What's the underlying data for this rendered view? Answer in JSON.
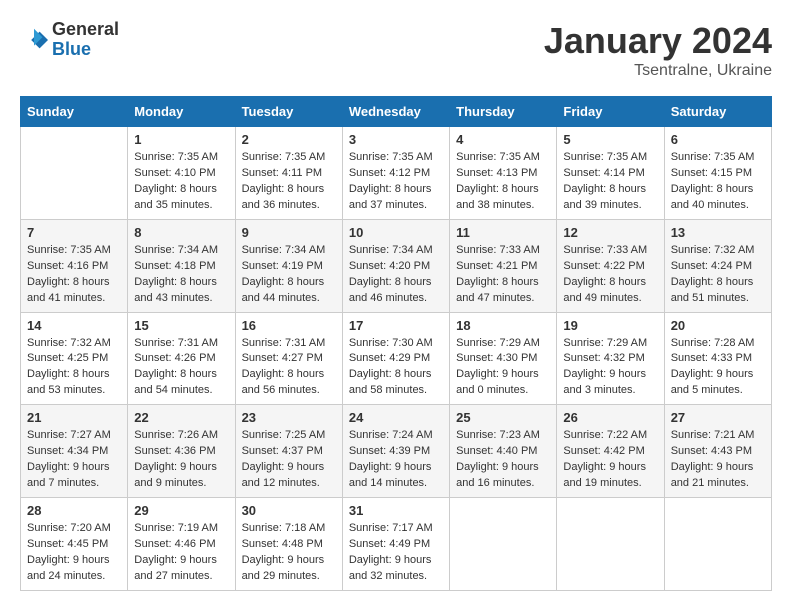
{
  "logo": {
    "general": "General",
    "blue": "Blue"
  },
  "header": {
    "month": "January 2024",
    "location": "Tsentralne, Ukraine"
  },
  "days_of_week": [
    "Sunday",
    "Monday",
    "Tuesday",
    "Wednesday",
    "Thursday",
    "Friday",
    "Saturday"
  ],
  "weeks": [
    [
      {
        "day": "",
        "info": ""
      },
      {
        "day": "1",
        "info": "Sunrise: 7:35 AM\nSunset: 4:10 PM\nDaylight: 8 hours\nand 35 minutes."
      },
      {
        "day": "2",
        "info": "Sunrise: 7:35 AM\nSunset: 4:11 PM\nDaylight: 8 hours\nand 36 minutes."
      },
      {
        "day": "3",
        "info": "Sunrise: 7:35 AM\nSunset: 4:12 PM\nDaylight: 8 hours\nand 37 minutes."
      },
      {
        "day": "4",
        "info": "Sunrise: 7:35 AM\nSunset: 4:13 PM\nDaylight: 8 hours\nand 38 minutes."
      },
      {
        "day": "5",
        "info": "Sunrise: 7:35 AM\nSunset: 4:14 PM\nDaylight: 8 hours\nand 39 minutes."
      },
      {
        "day": "6",
        "info": "Sunrise: 7:35 AM\nSunset: 4:15 PM\nDaylight: 8 hours\nand 40 minutes."
      }
    ],
    [
      {
        "day": "7",
        "info": "Sunrise: 7:35 AM\nSunset: 4:16 PM\nDaylight: 8 hours\nand 41 minutes."
      },
      {
        "day": "8",
        "info": "Sunrise: 7:34 AM\nSunset: 4:18 PM\nDaylight: 8 hours\nand 43 minutes."
      },
      {
        "day": "9",
        "info": "Sunrise: 7:34 AM\nSunset: 4:19 PM\nDaylight: 8 hours\nand 44 minutes."
      },
      {
        "day": "10",
        "info": "Sunrise: 7:34 AM\nSunset: 4:20 PM\nDaylight: 8 hours\nand 46 minutes."
      },
      {
        "day": "11",
        "info": "Sunrise: 7:33 AM\nSunset: 4:21 PM\nDaylight: 8 hours\nand 47 minutes."
      },
      {
        "day": "12",
        "info": "Sunrise: 7:33 AM\nSunset: 4:22 PM\nDaylight: 8 hours\nand 49 minutes."
      },
      {
        "day": "13",
        "info": "Sunrise: 7:32 AM\nSunset: 4:24 PM\nDaylight: 8 hours\nand 51 minutes."
      }
    ],
    [
      {
        "day": "14",
        "info": "Sunrise: 7:32 AM\nSunset: 4:25 PM\nDaylight: 8 hours\nand 53 minutes."
      },
      {
        "day": "15",
        "info": "Sunrise: 7:31 AM\nSunset: 4:26 PM\nDaylight: 8 hours\nand 54 minutes."
      },
      {
        "day": "16",
        "info": "Sunrise: 7:31 AM\nSunset: 4:27 PM\nDaylight: 8 hours\nand 56 minutes."
      },
      {
        "day": "17",
        "info": "Sunrise: 7:30 AM\nSunset: 4:29 PM\nDaylight: 8 hours\nand 58 minutes."
      },
      {
        "day": "18",
        "info": "Sunrise: 7:29 AM\nSunset: 4:30 PM\nDaylight: 9 hours\nand 0 minutes."
      },
      {
        "day": "19",
        "info": "Sunrise: 7:29 AM\nSunset: 4:32 PM\nDaylight: 9 hours\nand 3 minutes."
      },
      {
        "day": "20",
        "info": "Sunrise: 7:28 AM\nSunset: 4:33 PM\nDaylight: 9 hours\nand 5 minutes."
      }
    ],
    [
      {
        "day": "21",
        "info": "Sunrise: 7:27 AM\nSunset: 4:34 PM\nDaylight: 9 hours\nand 7 minutes."
      },
      {
        "day": "22",
        "info": "Sunrise: 7:26 AM\nSunset: 4:36 PM\nDaylight: 9 hours\nand 9 minutes."
      },
      {
        "day": "23",
        "info": "Sunrise: 7:25 AM\nSunset: 4:37 PM\nDaylight: 9 hours\nand 12 minutes."
      },
      {
        "day": "24",
        "info": "Sunrise: 7:24 AM\nSunset: 4:39 PM\nDaylight: 9 hours\nand 14 minutes."
      },
      {
        "day": "25",
        "info": "Sunrise: 7:23 AM\nSunset: 4:40 PM\nDaylight: 9 hours\nand 16 minutes."
      },
      {
        "day": "26",
        "info": "Sunrise: 7:22 AM\nSunset: 4:42 PM\nDaylight: 9 hours\nand 19 minutes."
      },
      {
        "day": "27",
        "info": "Sunrise: 7:21 AM\nSunset: 4:43 PM\nDaylight: 9 hours\nand 21 minutes."
      }
    ],
    [
      {
        "day": "28",
        "info": "Sunrise: 7:20 AM\nSunset: 4:45 PM\nDaylight: 9 hours\nand 24 minutes."
      },
      {
        "day": "29",
        "info": "Sunrise: 7:19 AM\nSunset: 4:46 PM\nDaylight: 9 hours\nand 27 minutes."
      },
      {
        "day": "30",
        "info": "Sunrise: 7:18 AM\nSunset: 4:48 PM\nDaylight: 9 hours\nand 29 minutes."
      },
      {
        "day": "31",
        "info": "Sunrise: 7:17 AM\nSunset: 4:49 PM\nDaylight: 9 hours\nand 32 minutes."
      },
      {
        "day": "",
        "info": ""
      },
      {
        "day": "",
        "info": ""
      },
      {
        "day": "",
        "info": ""
      }
    ]
  ]
}
